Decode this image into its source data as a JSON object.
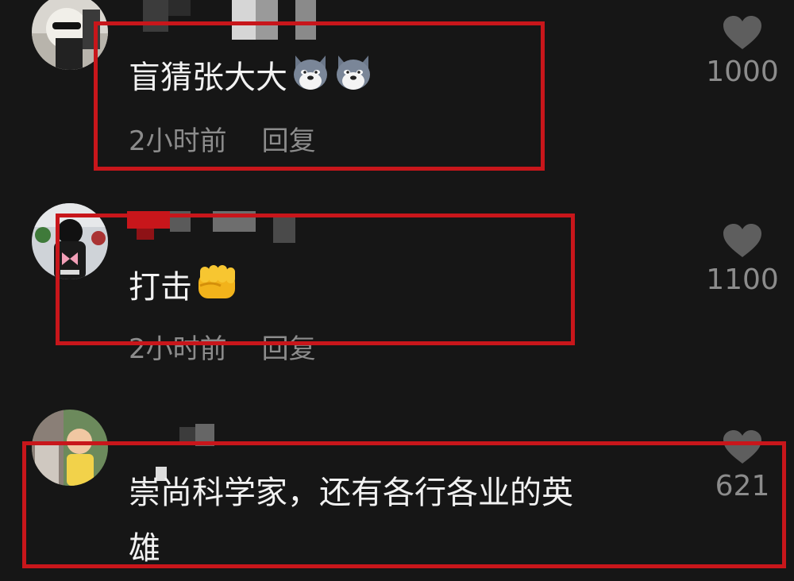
{
  "comments": [
    {
      "text": "盲猜张大大",
      "emojis": [
        "wolf-face-emoji",
        "wolf-face-emoji"
      ],
      "time": "2小时前",
      "reply": "回复",
      "likes": "1000"
    },
    {
      "text": "打击",
      "emojis": [
        "fist-emoji"
      ],
      "time": "2小时前",
      "reply": "回复",
      "likes": "1100"
    },
    {
      "text_line1": "崇尚科学家，还有各行各业的英",
      "text_line2": "雄",
      "likes": "621"
    }
  ],
  "colors": {
    "background": "#161616",
    "highlight_box": "#c8161b",
    "meta_text": "#8c8c8c",
    "heart": "#5e5e5e"
  }
}
